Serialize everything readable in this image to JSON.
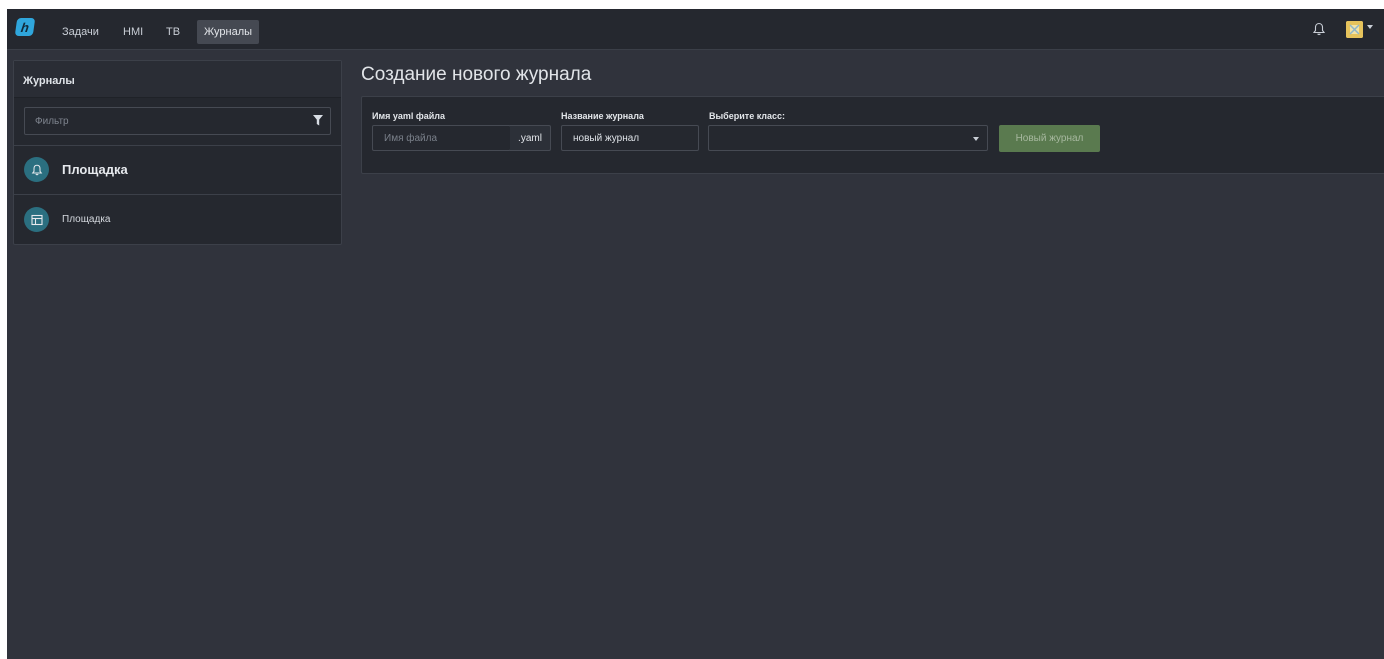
{
  "navbar": {
    "logo_letter": "h",
    "items": [
      {
        "label": "Задачи",
        "active": false
      },
      {
        "label": "HMI",
        "active": false
      },
      {
        "label": "TB",
        "active": false
      },
      {
        "label": "Журналы",
        "active": true
      }
    ],
    "icons": [
      "bell-icon",
      "avatar"
    ]
  },
  "sidebar": {
    "title": "Журналы",
    "filter_placeholder": "Фильтр",
    "group": {
      "label": "Площадка",
      "icon": "bell-icon"
    },
    "items": [
      {
        "label": "Площадка",
        "icon": "table-icon"
      }
    ]
  },
  "main": {
    "title": "Создание нового журнала",
    "form": {
      "file_label": "Имя yaml файла",
      "file_placeholder": "Имя файла",
      "file_value": "",
      "file_suffix": ".yaml",
      "name_label": "Название журнала",
      "name_value": "новый журнал",
      "class_label": "Выберите класс:",
      "class_value": "",
      "submit_label": "Новый журнал"
    }
  },
  "colors": {
    "page_bg": "#30333c",
    "navbar_bg": "#25282f",
    "accent_circle": "#2b6f80",
    "button_disabled": "#5a7a4f",
    "logo": "#2fa6dc"
  }
}
